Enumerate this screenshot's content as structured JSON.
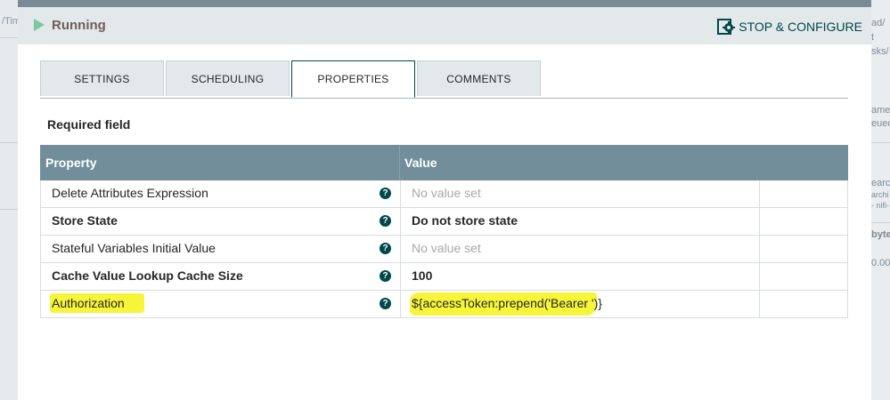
{
  "header": {
    "status_label": "Running",
    "stop_configure_label": "STOP & CONFIGURE"
  },
  "tabs": [
    {
      "label": "SETTINGS",
      "active": false
    },
    {
      "label": "SCHEDULING",
      "active": false
    },
    {
      "label": "PROPERTIES",
      "active": true
    },
    {
      "label": "COMMENTS",
      "active": false
    }
  ],
  "required_field_label": "Required field",
  "table": {
    "columns": [
      "Property",
      "Value"
    ],
    "rows": [
      {
        "property": "Delete Attributes Expression",
        "value": "No value set",
        "required": false,
        "empty": true
      },
      {
        "property": "Store State",
        "value": "Do not store state",
        "required": true,
        "empty": false
      },
      {
        "property": "Stateful Variables Initial Value",
        "value": "No value set",
        "required": false,
        "empty": true
      },
      {
        "property": "Cache Value Lookup Cache Size",
        "value": "100",
        "required": true,
        "empty": false
      },
      {
        "property": "Authorization",
        "value": "${accessToken:prepend('Bearer ')}",
        "required": false,
        "empty": false,
        "highlighted": true
      }
    ]
  },
  "icons": {
    "status": "play-icon",
    "stop": "gear-icon",
    "help": "question-icon"
  },
  "colors": {
    "accent": "#004849",
    "header_bg": "#728e9b",
    "highlight": "#f7f53a",
    "run_green": "#7dc7a0"
  },
  "background": {
    "left_fragments": [
      "/Tim"
    ],
    "right_fragments": [
      "ad/",
      "t",
      "sks/",
      "ame",
      "euec",
      "earc",
      "archi",
      "- nifi-",
      "byte",
      "0.00"
    ]
  }
}
